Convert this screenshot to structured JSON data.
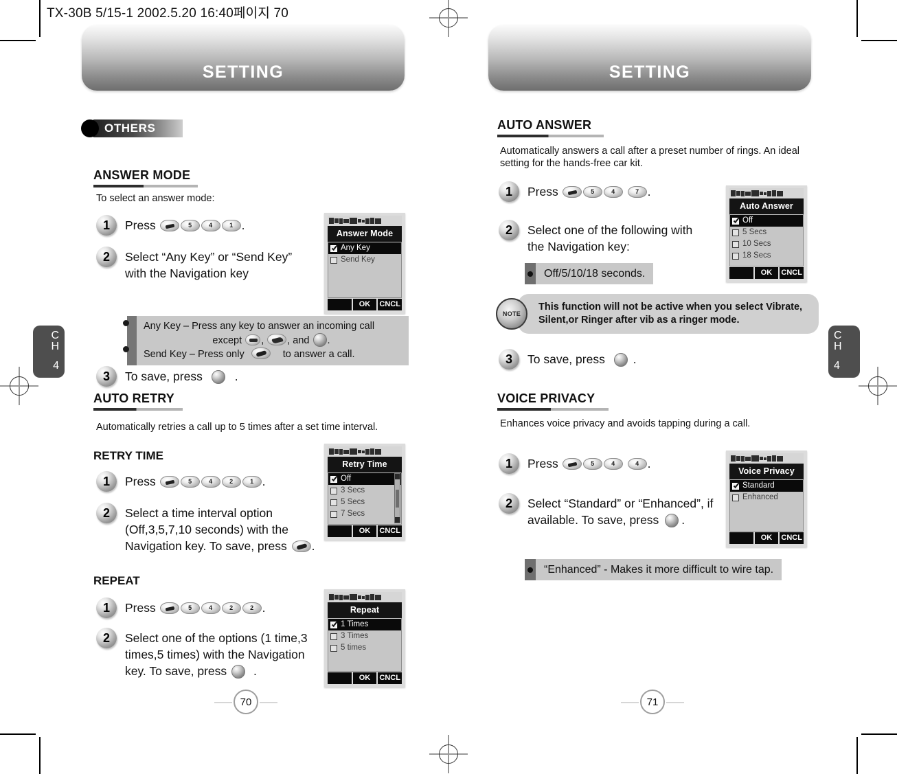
{
  "doc_header": "TX-30B 5/15-1  2002.5.20 16:40페이지 70",
  "left_page": {
    "banner_title": "SETTING",
    "tag": {
      "label": "OTHERS"
    },
    "chapter_tab": {
      "line1": "C",
      "line2": "H",
      "number": "4"
    },
    "page_number": "70",
    "sections": [
      {
        "heading": "ANSWER MODE",
        "intro": "To select an answer mode:",
        "steps": [
          {
            "num": "1",
            "text_before": "Press",
            "keys": [
              "menu",
              "5",
              "4",
              "1"
            ],
            "text_after": "."
          },
          {
            "num": "2",
            "text": "Select “Any Key” or “Send Key” with the Navigation key"
          },
          {
            "num": "3",
            "text_before": "To save, press",
            "keys": [
              "ok"
            ],
            "text_after": "."
          }
        ],
        "callout": {
          "line1a": "Any Key – Press any key to answer an incoming call",
          "line1b": "except",
          "line1c": ", and",
          "line1d": ".",
          "line2a": "Send Key – Press only",
          "line2b": "to answer a call."
        },
        "phone": {
          "title": "Answer Mode",
          "options": [
            {
              "label": "Any Key",
              "checked": true,
              "selected": true
            },
            {
              "label": "Send Key",
              "checked": false,
              "selected": false
            }
          ],
          "softkeys": [
            "",
            "OK",
            "CNCL"
          ],
          "scrollbar": false
        }
      },
      {
        "heading": "AUTO RETRY",
        "intro": "Automatically retries a call up to 5 times after a set time interval.",
        "sub_sections": [
          {
            "sub_heading": "RETRY TIME",
            "steps": [
              {
                "num": "1",
                "text_before": "Press",
                "keys": [
                  "menu",
                  "5",
                  "4",
                  "2",
                  "1"
                ],
                "text_after": "."
              },
              {
                "num": "2",
                "text": "Select a time interval option (Off,3,5,7,10 seconds) with the Navigation key. To save, press",
                "trailing_key": "send",
                "text_after": "."
              }
            ],
            "phone": {
              "title": "Retry Time",
              "options": [
                {
                  "label": "Off",
                  "checked": true,
                  "selected": true
                },
                {
                  "label": "3 Secs",
                  "checked": false,
                  "selected": false
                },
                {
                  "label": "5 Secs",
                  "checked": false,
                  "selected": false
                },
                {
                  "label": "7 Secs",
                  "checked": false,
                  "selected": false
                }
              ],
              "softkeys": [
                "",
                "OK",
                "CNCL"
              ],
              "scrollbar": true
            }
          },
          {
            "sub_heading": "REPEAT",
            "steps": [
              {
                "num": "1",
                "text_before": "Press",
                "keys": [
                  "menu",
                  "5",
                  "4",
                  "2",
                  "2"
                ],
                "text_after": "."
              },
              {
                "num": "2",
                "text": "Select one of the options (1 time,3 times,5 times) with the Navigation key. To save, press",
                "trailing_key": "ok",
                "text_after": "."
              }
            ],
            "phone": {
              "title": "Repeat",
              "options": [
                {
                  "label": "1 Times",
                  "checked": true,
                  "selected": true
                },
                {
                  "label": "3 Times",
                  "checked": false,
                  "selected": false
                },
                {
                  "label": "5 times",
                  "checked": false,
                  "selected": false
                }
              ],
              "softkeys": [
                "",
                "OK",
                "CNCL"
              ],
              "scrollbar": false
            }
          }
        ]
      }
    ]
  },
  "right_page": {
    "banner_title": "SETTING",
    "chapter_tab": {
      "line1": "C",
      "line2": "H",
      "number": "4"
    },
    "page_number": "71",
    "sections": [
      {
        "heading": "AUTO ANSWER",
        "intro": "Automatically answers a call after a preset number of rings. An ideal setting for the hands-free car kit.",
        "steps": [
          {
            "num": "1",
            "text_before": "Press",
            "keys": [
              "menu",
              "5",
              "4",
              "7"
            ],
            "text_after": "."
          },
          {
            "num": "2",
            "text": "Select one of the following with the Navigation key:"
          },
          {
            "num": "3",
            "text_before": "To save, press",
            "keys": [
              "ok"
            ],
            "text_after": "."
          }
        ],
        "mini_callout": "Off/5/10/18 seconds.",
        "note": {
          "icon_label": "NOTE",
          "text": "This function will not be active when you select Vibrate, Silent,or Ringer after vib as a ringer mode."
        },
        "phone": {
          "title": "Auto Answer",
          "options": [
            {
              "label": "Off",
              "checked": true,
              "selected": true
            },
            {
              "label": "5 Secs",
              "checked": false,
              "selected": false
            },
            {
              "label": "10 Secs",
              "checked": false,
              "selected": false
            },
            {
              "label": "18 Secs",
              "checked": false,
              "selected": false
            }
          ],
          "softkeys": [
            "",
            "OK",
            "CNCL"
          ],
          "scrollbar": false
        }
      },
      {
        "heading": "VOICE PRIVACY",
        "intro": "Enhances voice privacy and avoids tapping during a call.",
        "steps": [
          {
            "num": "1",
            "text_before": "Press",
            "keys": [
              "menu",
              "5",
              "4",
              "4"
            ],
            "text_after": "."
          },
          {
            "num": "2",
            "text": "Select “Standard” or “Enhanced”, if available. To save, press",
            "trailing_key": "ok",
            "text_after": "."
          }
        ],
        "mini_callout": "“Enhanced” - Makes it more difficult to wire tap.",
        "phone": {
          "title": "Voice Privacy",
          "options": [
            {
              "label": "Standard",
              "checked": true,
              "selected": true
            },
            {
              "label": "Enhanced",
              "checked": false,
              "selected": false
            }
          ],
          "softkeys": [
            "",
            "OK",
            "CNCL"
          ],
          "scrollbar": false
        }
      }
    ]
  }
}
